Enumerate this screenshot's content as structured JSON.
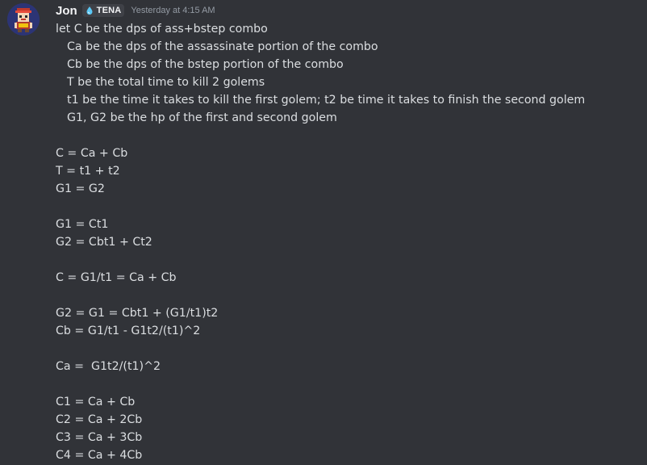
{
  "message": {
    "username": "Jon",
    "tag": "TENA",
    "timestamp": "Yesterday at 4:15 AM",
    "colors": {
      "background": "#313338",
      "username": "#f2f3f5",
      "timestamp": "#949ba4",
      "text": "#dbdee1",
      "tag_bg": "#3f4147",
      "tag_icon": "#5cc8f5"
    },
    "icons": {
      "tag_icon": "water-drop-icon",
      "avatar": "user-avatar-image"
    },
    "lines": [
      "let C be the dps of ass+bstep combo",
      "Ca be the dps of the assassinate portion of the combo",
      "Cb be the dps of the bstep portion of the combo",
      "T be the total time to kill 2 golems",
      "t1 be the time it takes to kill the first golem; t2 be time it takes to finish the second golem",
      "G1, G2 be the hp of the first and second golem",
      "",
      "C = Ca + Cb",
      "T = t1 + t2",
      "G1 = G2",
      "",
      "G1 = Ct1",
      "G2 = Cbt1 + Ct2",
      "",
      "C = G1/t1 = Ca + Cb",
      "",
      "G2 = G1 = Cbt1 + (G1/t1)t2",
      "Cb = G1/t1 - G1t2/(t1)^2",
      "",
      "Ca =  G1t2/(t1)^2",
      "",
      "C1 = Ca + Cb",
      "C2 = Ca + 2Cb",
      "C3 = Ca + 3Cb",
      "C4 = Ca + 4Cb"
    ]
  }
}
